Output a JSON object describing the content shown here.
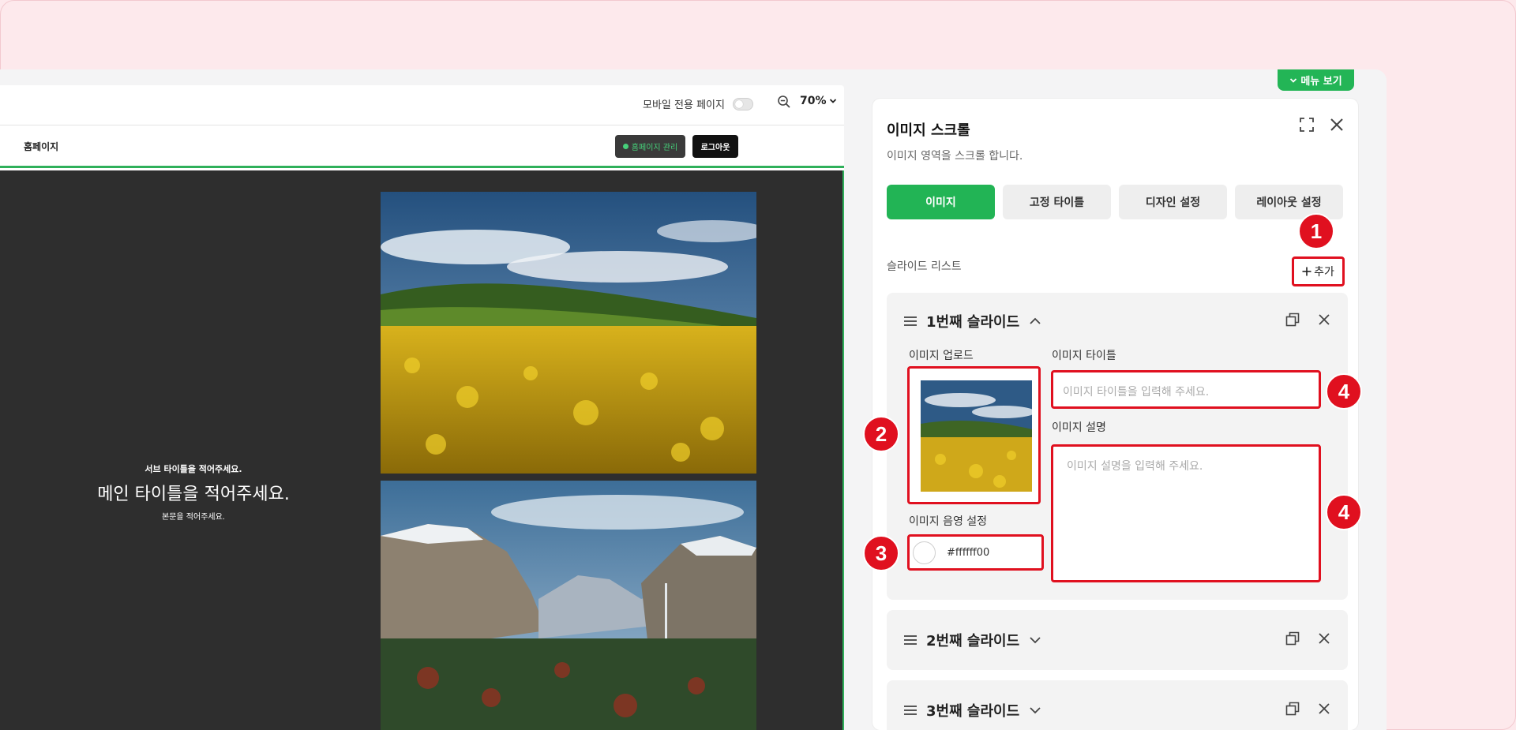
{
  "editor": {
    "mobile_only_label": "모바일 전용 페이지",
    "zoom_label": "70%",
    "site_name": "홈페이지",
    "manage_label": "홈페이지 관리",
    "logout_label": "로그아웃",
    "hero": {
      "sub_title": "서브 타이틀을 적어주세요.",
      "main_title": "메인 타이틀을 적어주세요.",
      "body": "본문을 적어주세요."
    }
  },
  "menu_toggle_label": "메뉴 보기",
  "panel": {
    "title": "이미지 스크롤",
    "description": "이미지 영역을 스크롤 합니다.",
    "tabs": [
      {
        "label": "이미지",
        "active": true
      },
      {
        "label": "고정 타이틀",
        "active": false
      },
      {
        "label": "디자인 설정",
        "active": false
      },
      {
        "label": "레이아웃 설정",
        "active": false
      }
    ],
    "slide_list_label": "슬라이드 리스트",
    "add_label": "추가",
    "slides": [
      {
        "title": "1번째 슬라이드",
        "expanded": true,
        "image_upload_label": "이미지 업로드",
        "image_title_label": "이미지 타이틀",
        "image_title_placeholder": "이미지 타이틀을 입력해 주세요.",
        "image_desc_label": "이미지 설명",
        "image_desc_placeholder": "이미지 설명을 입력해 주세요.",
        "shade_label": "이미지 음영 설정",
        "shade_value": "#ffffff00"
      },
      {
        "title": "2번째 슬라이드",
        "expanded": false
      },
      {
        "title": "3번째 슬라이드",
        "expanded": false
      }
    ]
  },
  "annotations": [
    "1",
    "2",
    "3",
    "4",
    "4"
  ],
  "colors": {
    "accent": "#22b455",
    "highlight": "#e0101f",
    "preview_bg": "#2e2e2e",
    "page_bg": "#fde9ec"
  }
}
